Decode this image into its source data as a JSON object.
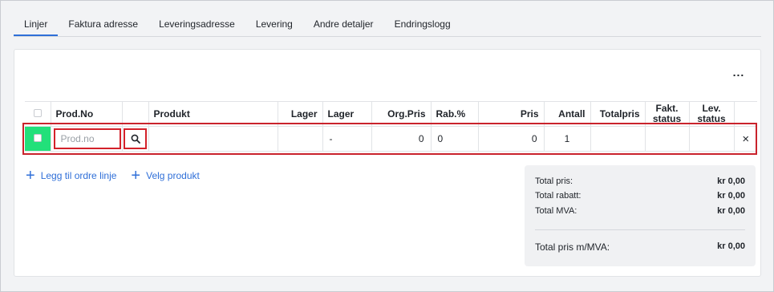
{
  "tabs": [
    {
      "label": "Linjer",
      "active": true
    },
    {
      "label": "Faktura adresse",
      "active": false
    },
    {
      "label": "Leveringsadresse",
      "active": false
    },
    {
      "label": "Levering",
      "active": false
    },
    {
      "label": "Andre detaljer",
      "active": false
    },
    {
      "label": "Endringslogg",
      "active": false
    }
  ],
  "toolbar": {
    "more_label": "..."
  },
  "table": {
    "headers": {
      "prod_no": "Prod.No",
      "produkt": "Produkt",
      "lager1": "Lager",
      "lager2": "Lager",
      "org_pris": "Org.Pris",
      "rab": "Rab.%",
      "pris": "Pris",
      "antall": "Antall",
      "totalpris": "Totalpris",
      "fakt_status": "Fakt. status",
      "lev_status": "Lev. status"
    },
    "row": {
      "prod_no_placeholder": "Prod.no",
      "produkt": "",
      "lager1": "",
      "lager2": "-",
      "org_pris": "0",
      "rab": "0",
      "pris": "0",
      "antall": "1",
      "totalpris": "",
      "fakt_status": "",
      "lev_status": "",
      "remove": "×"
    }
  },
  "actions": {
    "add_line": "Legg til ordre linje",
    "choose_product": "Velg produkt"
  },
  "summary": {
    "total_price_label": "Total pris:",
    "total_price_value": "kr 0,00",
    "total_discount_label": "Total rabatt:",
    "total_discount_value": "kr 0,00",
    "total_vat_label": "Total MVA:",
    "total_vat_value": "kr 0,00",
    "grand_total_label": "Total pris m/MVA:",
    "grand_total_value": "kr 0,00"
  },
  "colors": {
    "accent": "#2f6fd8",
    "selection": "#22e07a",
    "highlight_outline": "#c9232c"
  }
}
